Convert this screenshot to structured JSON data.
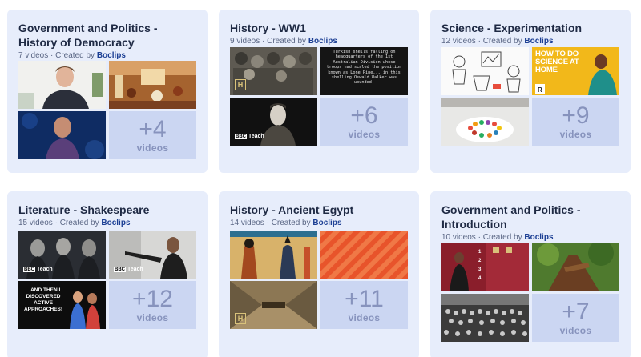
{
  "cards": [
    {
      "title": "Government and Politics - History of Democracy",
      "meta_prefix": "7 videos · Created by ",
      "creator": "Boclips",
      "more_count": "+4",
      "more_word": "videos"
    },
    {
      "title": "History - WW1",
      "meta_prefix": "9 videos · Created by ",
      "creator": "Boclips",
      "more_count": "+6",
      "more_word": "videos",
      "thumb_text": "Turkish shells falling on headquarters of the 1st Australian Division whose troops had scaled the position known as Lone Pine... in this shelling Oswald Walker was wounded."
    },
    {
      "title": "Science - Experimentation",
      "meta_prefix": "12 videos · Created by ",
      "creator": "Boclips",
      "more_count": "+9",
      "more_word": "videos",
      "thumb_text": "HOW TO DO SCIENCE AT HOME"
    },
    {
      "title": "Literature - Shakespeare",
      "meta_prefix": "15 videos · Created by ",
      "creator": "Boclips",
      "more_count": "+12",
      "more_word": "videos",
      "thumb_text": "...AND THEN I DISCOVERED ACTIVE APPROACHES!"
    },
    {
      "title": "History - Ancient Egypt",
      "meta_prefix": "14 videos · Created by ",
      "creator": "Boclips",
      "more_count": "+11",
      "more_word": "videos"
    },
    {
      "title": "Government and Politics - Introduction",
      "meta_prefix": "10 videos · Created by ",
      "creator": "Boclips",
      "more_count": "+7",
      "more_word": "videos"
    }
  ],
  "bbc_label": "BBC",
  "teach_label": "Teach",
  "history_logo": "H",
  "numbered_list": [
    "1",
    "2",
    "3",
    "4"
  ],
  "colors": {
    "card_bg": "#e7edfb",
    "more_bg": "#cbd6f2",
    "more_text": "#8793bd",
    "creator": "#1c3f94"
  }
}
